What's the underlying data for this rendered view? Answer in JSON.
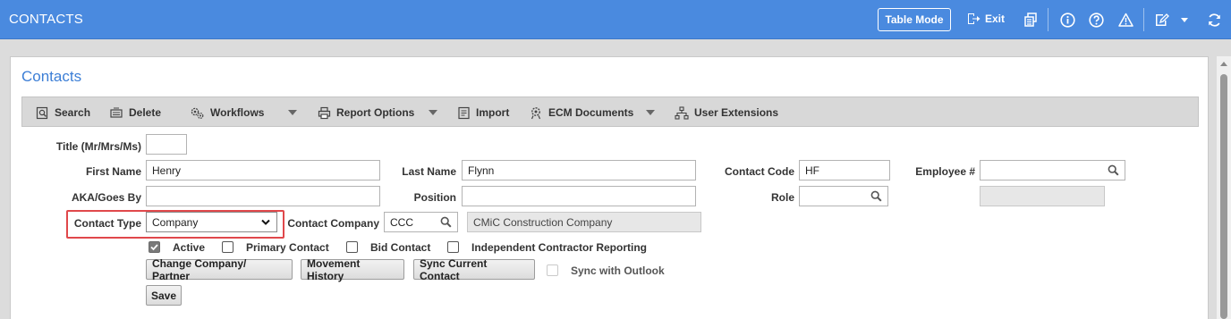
{
  "app": {
    "title": "CONTACTS",
    "table_mode_label": "Table Mode",
    "exit_label": "Exit"
  },
  "panel": {
    "title": "Contacts"
  },
  "toolbar": {
    "search": "Search",
    "delete": "Delete",
    "workflows": "Workflows",
    "report_options": "Report Options",
    "import": "Import",
    "ecm_documents": "ECM Documents",
    "user_extensions": "User Extensions"
  },
  "form": {
    "title_label": "Title (Mr/Mrs/Ms)",
    "title_value": "",
    "first_name_label": "First Name",
    "first_name_value": "Henry",
    "last_name_label": "Last Name",
    "last_name_value": "Flynn",
    "contact_code_label": "Contact Code",
    "contact_code_value": "HF",
    "employee_label": "Employee #",
    "employee_value": "",
    "aka_label": "AKA/Goes By",
    "aka_value": "",
    "position_label": "Position",
    "position_value": "",
    "role_label": "Role",
    "role_value": "",
    "contact_type_label": "Contact Type",
    "contact_type_value": "Company",
    "contact_company_label": "Contact Company",
    "contact_company_code": "CCC",
    "contact_company_name": "CMiC Construction Company"
  },
  "checkboxes": {
    "active": {
      "label": "Active",
      "checked": true
    },
    "primary_contact": {
      "label": "Primary Contact",
      "checked": false
    },
    "bid_contact": {
      "label": "Bid Contact",
      "checked": false
    },
    "independent_contractor": {
      "label": "Independent Contractor Reporting",
      "checked": false
    },
    "sync_outlook": {
      "label": "Sync with Outlook",
      "checked": false,
      "disabled": true
    }
  },
  "buttons": {
    "change_company": "Change Company/ Partner",
    "movement_history": "Movement History",
    "sync_current": "Sync Current Contact",
    "save": "Save"
  },
  "colors": {
    "topbar": "#4a8adf",
    "title_blue": "#3c7ed6",
    "highlight": "#e0484b"
  }
}
